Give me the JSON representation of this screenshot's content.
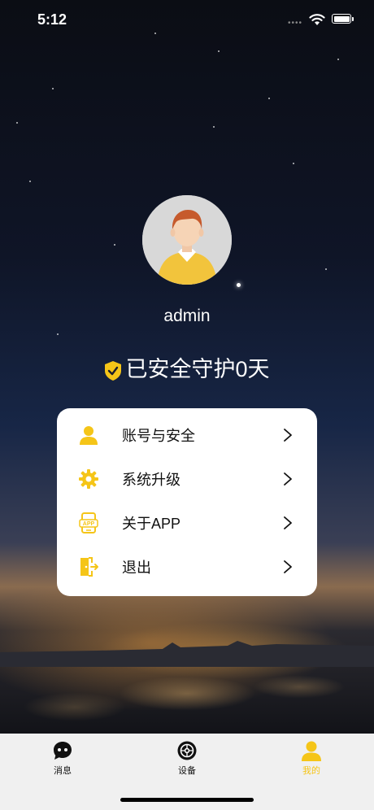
{
  "status_bar": {
    "time": "5:12"
  },
  "profile": {
    "username": "admin",
    "protect_text": "已安全守护0天"
  },
  "menu": {
    "items": [
      {
        "label": "账号与安全",
        "icon": "user-icon"
      },
      {
        "label": "系统升级",
        "icon": "gear-icon"
      },
      {
        "label": "关于APP",
        "icon": "app-icon"
      },
      {
        "label": "退出",
        "icon": "logout-icon"
      }
    ]
  },
  "tabbar": {
    "tabs": [
      {
        "label": "消息",
        "icon": "message-icon",
        "active": false
      },
      {
        "label": "设备",
        "icon": "device-icon",
        "active": false
      },
      {
        "label": "我的",
        "icon": "user-icon",
        "active": true
      }
    ]
  },
  "colors": {
    "accent": "#f5c518",
    "card": "#ffffff",
    "tabbar": "#f0f0f0"
  }
}
